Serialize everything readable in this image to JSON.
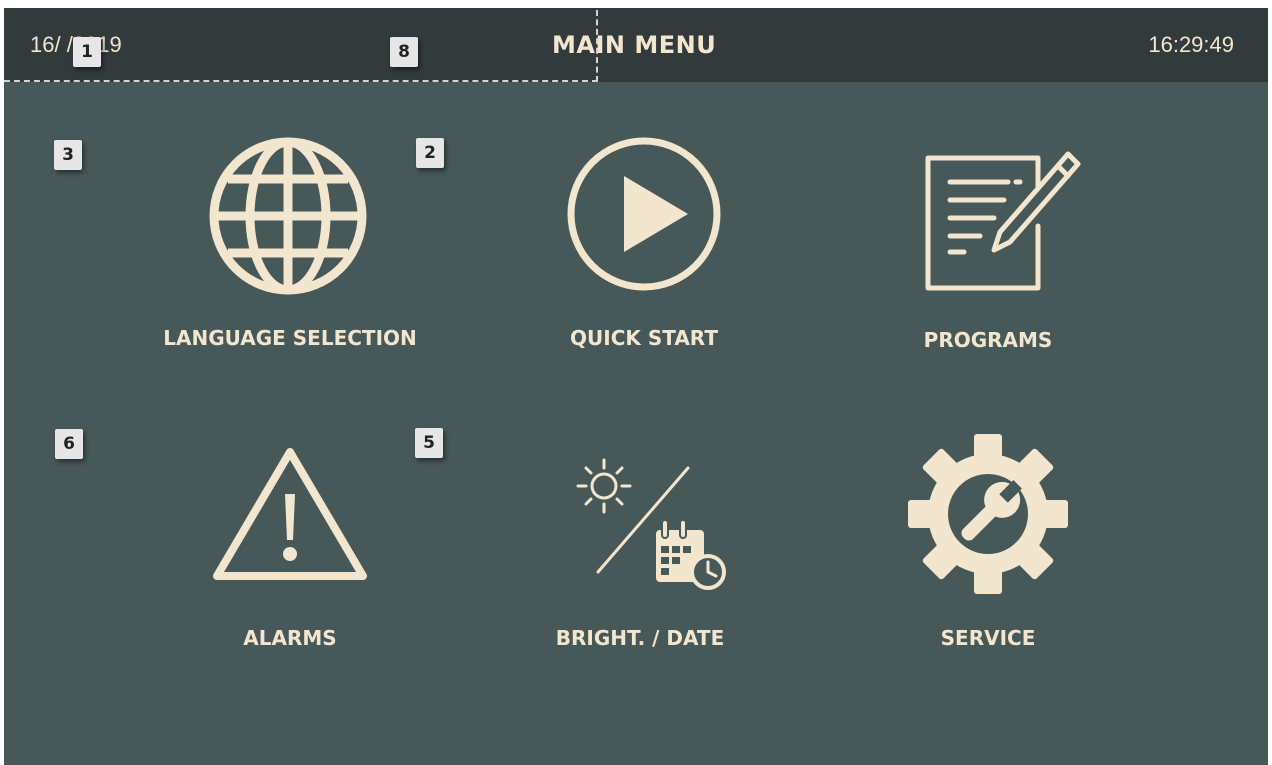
{
  "header": {
    "date": "16/ /2019",
    "title": "MAIN MENU",
    "time": "16:29:49"
  },
  "menu": {
    "language_label": "LANGUAGE SELECTION",
    "quick_start_label": "QUICK START",
    "programs_label": "PROGRAMS",
    "alarms_label": "ALARMS",
    "bright_date_label": "BRIGHT. / DATE",
    "service_label": "SERVICE"
  },
  "badges": {
    "b1": "1",
    "b2": "2",
    "b3": "3",
    "b5": "5",
    "b6": "6",
    "b8": "8"
  },
  "colors": {
    "background": "#475859",
    "header": "#333a3c",
    "foreground": "#f3e6cf"
  },
  "icons": [
    "globe-icon",
    "play-icon",
    "notepad-edit-icon",
    "warning-icon",
    "brightness-date-icon",
    "gear-wrench-icon"
  ]
}
